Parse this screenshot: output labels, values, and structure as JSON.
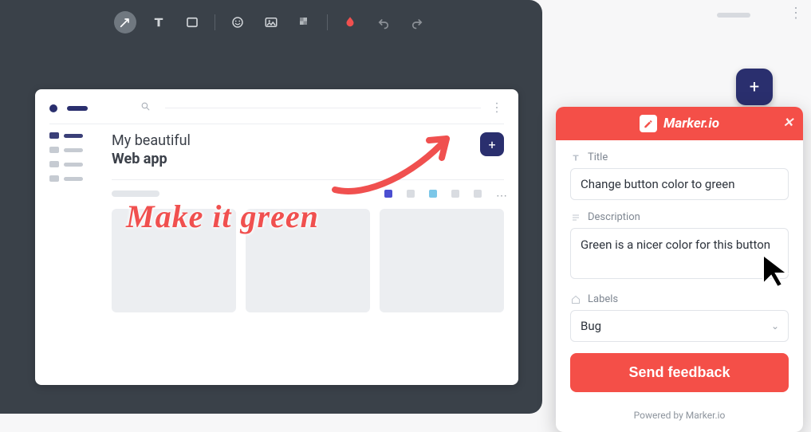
{
  "colors": {
    "accent": "#f44f48",
    "brand_navy": "#2a2f6e"
  },
  "toolbar": {
    "tools": [
      "arrow",
      "text",
      "rect",
      "emoji",
      "image",
      "blur",
      "color",
      "undo",
      "redo"
    ]
  },
  "app": {
    "title_line1": "My beautiful",
    "title_line2": "Web app",
    "add_glyph": "+"
  },
  "annotation": {
    "text": "Make it green"
  },
  "fab": {
    "glyph": "+"
  },
  "panel": {
    "brand": "Marker.io",
    "title_label": "Title",
    "title_value": "Change button color to green",
    "description_label": "Description",
    "description_value": "Green is a nicer color for this button",
    "labels_label": "Labels",
    "labels_value": "Bug",
    "submit_label": "Send feedback",
    "footer_text": "Powered by Marker.io"
  }
}
